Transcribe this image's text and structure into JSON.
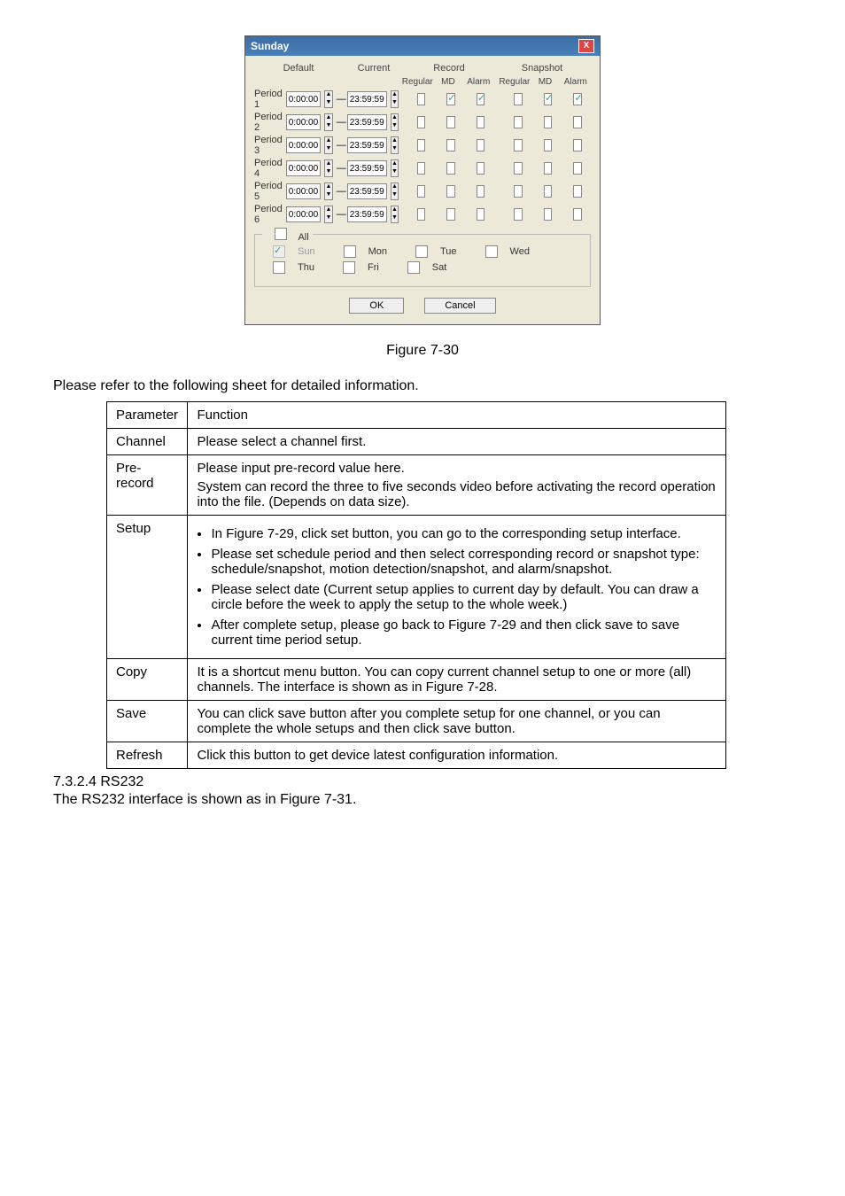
{
  "dialog": {
    "title": "Sunday",
    "headers": {
      "default": "Default",
      "current": "Current",
      "record": "Record",
      "snapshot": "Snapshot"
    },
    "sub": {
      "regular": "Regular",
      "md": "MD",
      "alarm": "Alarm"
    },
    "periods": [
      {
        "label": "Period 1",
        "from": "0:00:00",
        "to": "23:59:59",
        "r_reg": false,
        "r_md": true,
        "r_al": true,
        "s_reg": false,
        "s_md": true,
        "s_al": true
      },
      {
        "label": "Period 2",
        "from": "0:00:00",
        "to": "23:59:59",
        "r_reg": false,
        "r_md": false,
        "r_al": false,
        "s_reg": false,
        "s_md": false,
        "s_al": false
      },
      {
        "label": "Period 3",
        "from": "0:00:00",
        "to": "23:59:59",
        "r_reg": false,
        "r_md": false,
        "r_al": false,
        "s_reg": false,
        "s_md": false,
        "s_al": false
      },
      {
        "label": "Period 4",
        "from": "0:00:00",
        "to": "23:59:59",
        "r_reg": false,
        "r_md": false,
        "r_al": false,
        "s_reg": false,
        "s_md": false,
        "s_al": false
      },
      {
        "label": "Period 5",
        "from": "0:00:00",
        "to": "23:59:59",
        "r_reg": false,
        "r_md": false,
        "r_al": false,
        "s_reg": false,
        "s_md": false,
        "s_al": false
      },
      {
        "label": "Period 6",
        "from": "0:00:00",
        "to": "23:59:59",
        "r_reg": false,
        "r_md": false,
        "r_al": false,
        "s_reg": false,
        "s_md": false,
        "s_al": false
      }
    ],
    "all_label": "All",
    "days": {
      "sun": "Sun",
      "mon": "Mon",
      "tue": "Tue",
      "wed": "Wed",
      "thu": "Thu",
      "fri": "Fri",
      "sat": "Sat"
    },
    "ok": "OK",
    "cancel": "Cancel"
  },
  "figure_caption": "Figure 7-30",
  "intro": "Please refer to the following sheet for detailed information.",
  "table": {
    "head": {
      "param": "Parameter",
      "func": "Function"
    },
    "rows": {
      "channel": {
        "p": "Channel",
        "f": "Please select a channel first."
      },
      "prerecord": {
        "p": "Pre-record",
        "f1": "Please input pre-record value here.",
        "f2": "System can record the three to five seconds video before activating the record operation into the file. (Depends on data size)."
      },
      "setup": {
        "p": "Setup",
        "b1": "In Figure 7-29, click set button, you can go to the corresponding setup interface.",
        "b2": "Please set schedule period and then select corresponding record or snapshot type: schedule/snapshot, motion detection/snapshot, and alarm/snapshot.",
        "b3": "Please select date (Current setup applies to current day by default. You can draw a circle before the week to apply the setup to the whole week.)",
        "b4": "After complete setup, please go back to Figure 7-29 and then click save to save current time period setup."
      },
      "copy": {
        "p": "Copy",
        "f": "It is a shortcut menu button. You can copy current channel setup to one or more (all) channels.  The interface is shown as in Figure 7-28."
      },
      "save": {
        "p": "Save",
        "f": "You can click save button after you complete setup for one channel, or you can complete the whole setups and then click save button."
      },
      "refresh": {
        "p": "Refresh",
        "f": "Click this button to get device latest configuration information."
      }
    }
  },
  "section": {
    "num_title": "7.3.2.4  RS232",
    "body": "The RS232 interface is shown as in Figure 7-31."
  }
}
